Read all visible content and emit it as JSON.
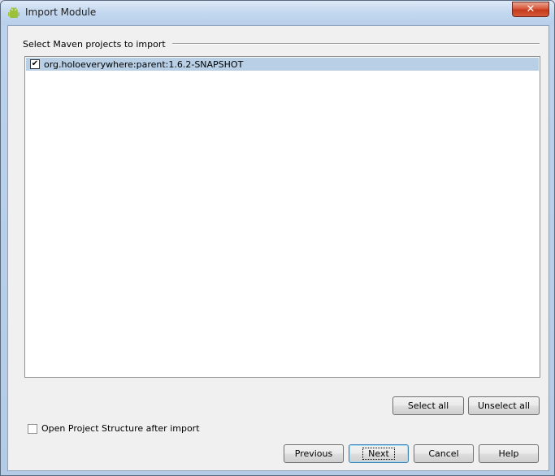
{
  "window": {
    "title": "Import Module",
    "close_label": "✕"
  },
  "group": {
    "label": "Select Maven projects to import"
  },
  "projects": [
    {
      "label": "org.holoeverywhere:parent:1.6.2-SNAPSHOT",
      "checked": true,
      "check_glyph": "✔"
    }
  ],
  "selection_buttons": {
    "select_all": "Select all",
    "unselect_all": "Unselect all"
  },
  "options": {
    "open_structure_label": "Open Project Structure after import",
    "open_structure_checked": false
  },
  "footer": {
    "previous": "Previous",
    "next": "Next",
    "cancel": "Cancel",
    "help": "Help"
  },
  "icons": {
    "app": "android-icon"
  },
  "colors": {
    "selection": "#b8cfe5",
    "close_button": "#c43a1c",
    "default_button_border": "#3c7fb1"
  }
}
